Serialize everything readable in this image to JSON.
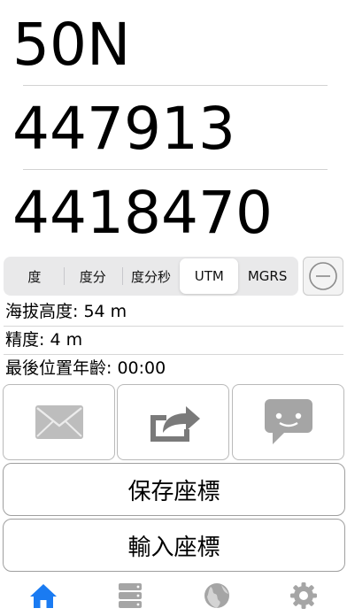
{
  "coordinates": {
    "zone": "50N",
    "easting": "447913",
    "northing": "4418470"
  },
  "format_selector": {
    "options": [
      "度",
      "度分",
      "度分秒",
      "UTM",
      "MGRS"
    ],
    "selected": "UTM"
  },
  "info": {
    "altitude": "海拔高度: 54 m",
    "accuracy": "精度: 4 m",
    "last_position_age": "最後位置年齡: 00:00"
  },
  "buttons": {
    "save": "保存座標",
    "input": "輸入座標"
  },
  "tabs": [
    {
      "icon": "home-icon",
      "active": true
    },
    {
      "icon": "list-icon",
      "active": false
    },
    {
      "icon": "globe-icon",
      "active": false
    },
    {
      "icon": "gear-icon",
      "active": false
    }
  ],
  "colors": {
    "accent": "#1a7bf2",
    "icon_gray": "#a5a5a5"
  }
}
